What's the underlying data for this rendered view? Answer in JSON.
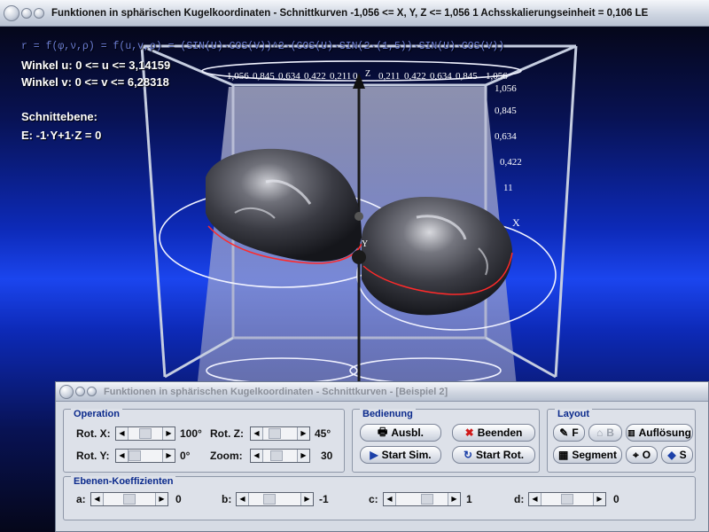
{
  "window": {
    "title": "Funktionen in sphärischen Kugelkoordinaten - Schnittkurven    -1,056 <= X, Y, Z <= 1,056    1 Achsskalierungseinheit = 0,106 LE"
  },
  "info": {
    "formula": "r = f(φ,ν,ρ) = f(u,v,ρ) = (SIN(U)·COS(V))^2·(COS(U)·SIN(2·(1,5))·SIN(U)·COS(V))",
    "winkel_u": "Winkel u: 0 <= u <= 3,14159",
    "winkel_v": "Winkel v: 0 <= v <= 6,28318",
    "schnittebene_label": "Schnittebene:",
    "ebene": "E: -1·Y+1·Z = 0"
  },
  "axis_ticks": {
    "top_row": [
      "1,056",
      "0,845",
      "0,634",
      "0,422",
      "0,211",
      "0",
      "0,211",
      "0,422",
      "0,634",
      "0,845",
      "1,056"
    ],
    "right_column": [
      "1,056",
      "0,845",
      "0,634",
      "0,422",
      "11"
    ],
    "labels": {
      "x": "X",
      "y": "Y",
      "z": "Z"
    }
  },
  "colors": {
    "viewport_blue": "#1b45ee",
    "cube_edges": "#c5cde0",
    "cut_curve": "#ff2a2a",
    "plane": "#9aa0c8",
    "group_title": "#0b2a8c"
  },
  "panel": {
    "title": "Funktionen in sphärischen Kugelkoordinaten - Schnittkurven - [Beispiel 2]",
    "operation": {
      "title": "Operation",
      "rot_x_label": "Rot. X:",
      "rot_x_value": "100°",
      "rot_y_label": "Rot. Y:",
      "rot_y_value": "0°",
      "rot_z_label": "Rot. Z:",
      "rot_z_value": "45°",
      "zoom_label": "Zoom:",
      "zoom_value": "30"
    },
    "bedienung": {
      "title": "Bedienung",
      "ausbl": "Ausbl.",
      "beenden": "Beenden",
      "start_sim": "Start Sim.",
      "start_rot": "Start Rot."
    },
    "layout": {
      "title": "Layout",
      "f": "F",
      "b": "B",
      "aufloesung": "Auflösung",
      "segment": "Segment",
      "o": "O",
      "s": "S"
    },
    "ebenen": {
      "title": "Ebenen-Koeffizienten",
      "a_label": "a:",
      "a_value": "0",
      "b_label": "b:",
      "b_value": "-1",
      "c_label": "c:",
      "c_value": "1",
      "d_label": "d:",
      "d_value": "0"
    }
  }
}
